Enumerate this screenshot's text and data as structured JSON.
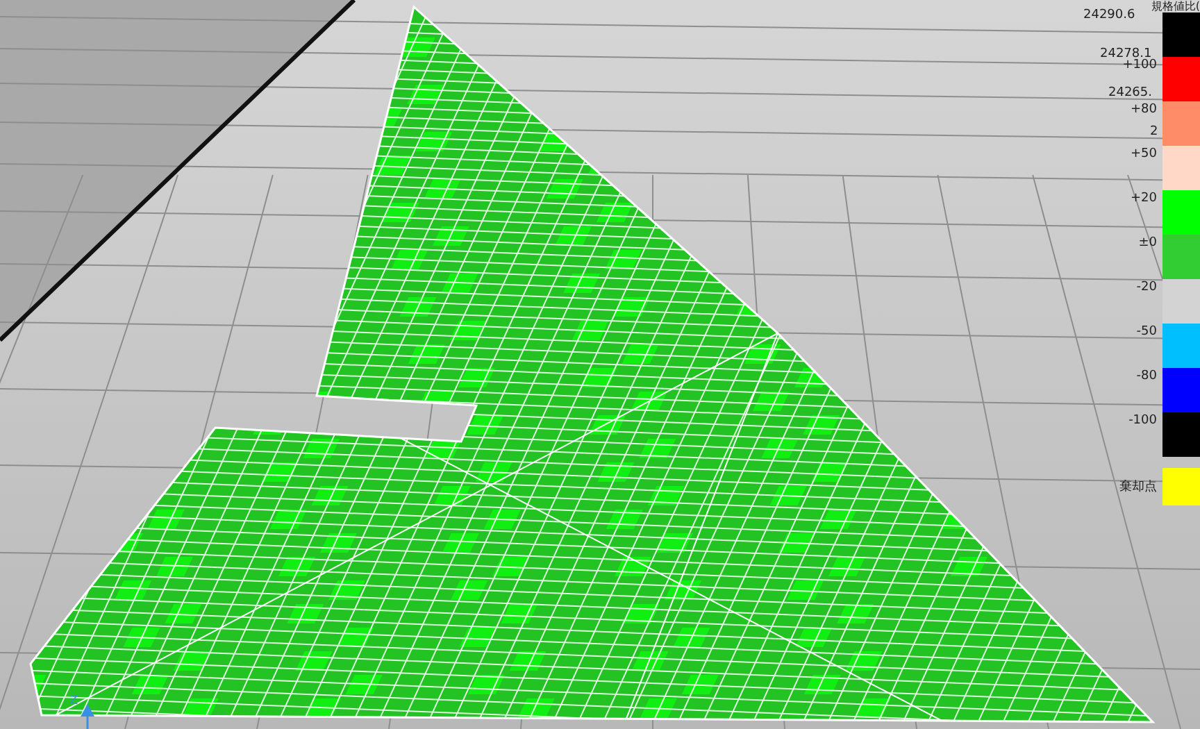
{
  "scene": {
    "axis_label": "Z"
  },
  "legend": {
    "title": "規格値比(",
    "elevations": [
      "24290.6",
      "24278.1",
      "24265.",
      "2"
    ],
    "items": [
      {
        "color": "#000000"
      },
      {
        "label": "+100",
        "color": "#ff0000"
      },
      {
        "label": "+80",
        "color": "#ff8c69"
      },
      {
        "label": "+50",
        "color": "#ffd8c8"
      },
      {
        "label": "+20",
        "color": "#00ff00"
      },
      {
        "label": "±0",
        "color": "#32cd32"
      },
      {
        "label": "-20",
        "color": "#d3d3d3"
      },
      {
        "label": "-50",
        "color": "#00bfff"
      },
      {
        "label": "-80",
        "color": "#0000ff"
      },
      {
        "label": "-100",
        "color": "#000000"
      }
    ],
    "reject": {
      "label": "棄却点",
      "color": "#ffff00"
    }
  }
}
